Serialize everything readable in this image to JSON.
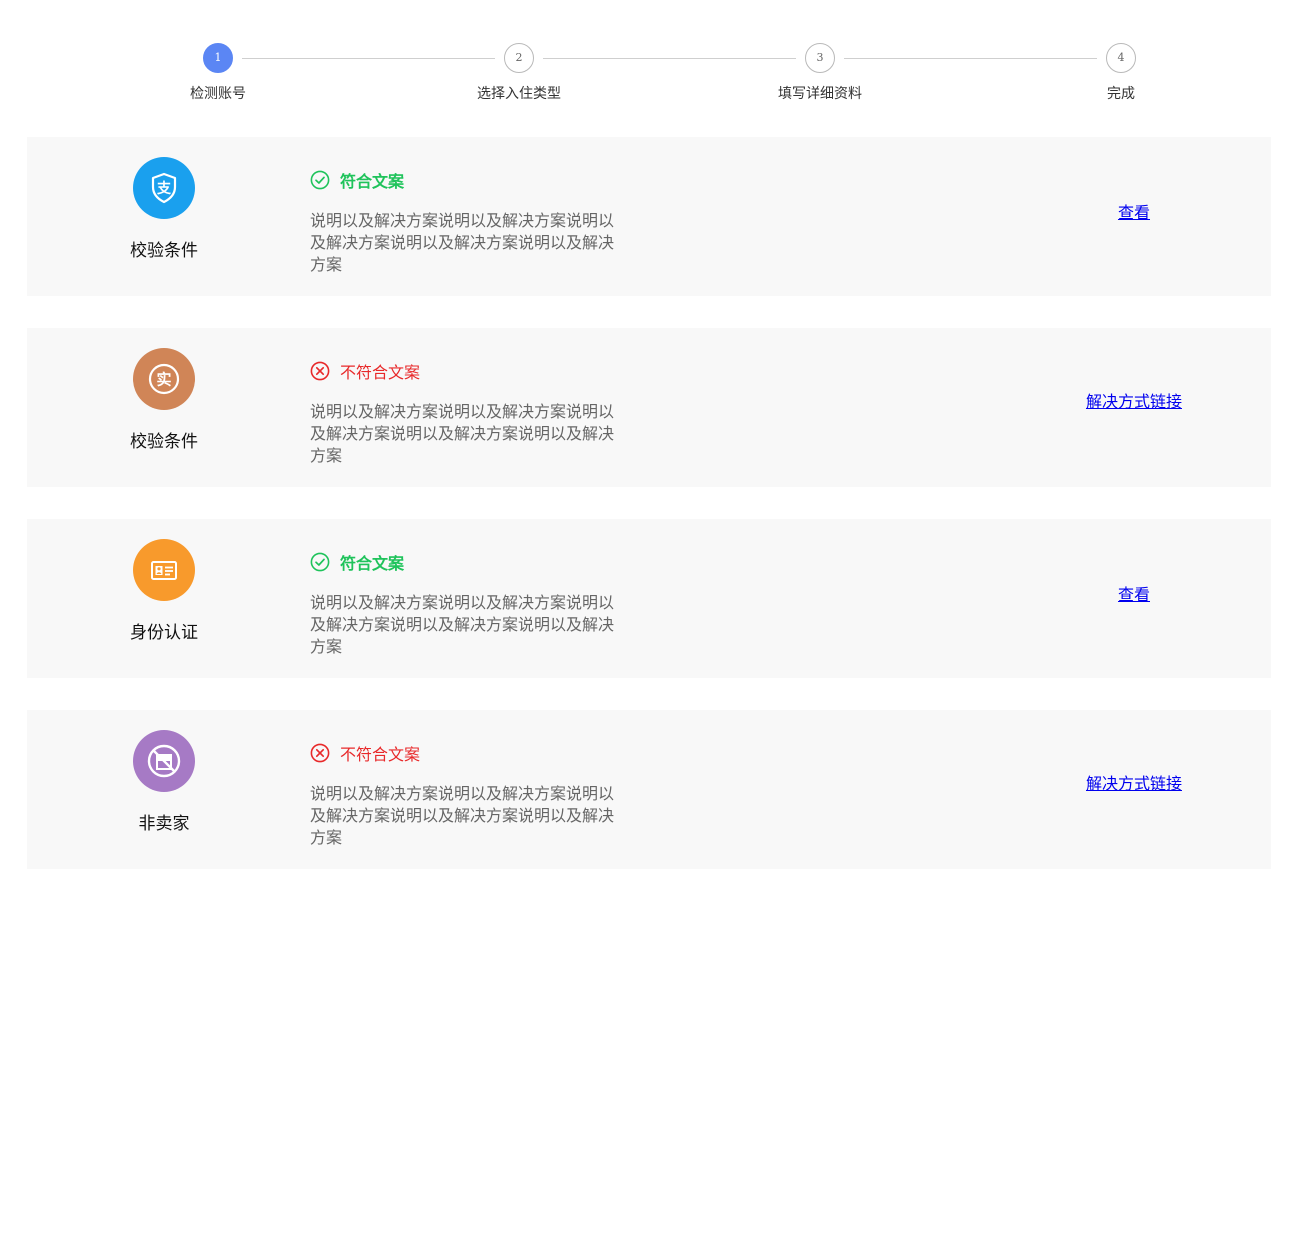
{
  "stepper": {
    "steps": [
      {
        "number": "1",
        "label": "检测账号",
        "state": "active"
      },
      {
        "number": "2",
        "label": "选择入住类型",
        "state": "pending"
      },
      {
        "number": "3",
        "label": "填写详细资料",
        "state": "pending"
      },
      {
        "number": "4",
        "label": "完成",
        "state": "pending"
      }
    ],
    "active_color": "#5b86f4"
  },
  "checks": [
    {
      "name": "校验条件",
      "icon": "alipay-icon",
      "icon_color": "#1aa0ee",
      "status": "pass",
      "status_text": "符合文案",
      "description": "说明以及解决方案说明以及解决方案说明以及解决方案说明以及解决方案说明以及解决方案",
      "link_text": "查看"
    },
    {
      "name": "校验条件",
      "icon": "real-name-icon",
      "icon_color": "#d08557",
      "status": "fail",
      "status_text": "不符合文案",
      "description": "说明以及解决方案说明以及解决方案说明以及解决方案说明以及解决方案说明以及解决方案",
      "link_text": "解决方式链接"
    },
    {
      "name": "身份认证",
      "icon": "id-card-icon",
      "icon_color": "#f89a2c",
      "status": "pass",
      "status_text": "符合文案",
      "description": "说明以及解决方案说明以及解决方案说明以及解决方案说明以及解决方案说明以及解决方案",
      "link_text": "查看"
    },
    {
      "name": "非卖家",
      "icon": "no-store-icon",
      "icon_color": "#a67ac5",
      "status": "fail",
      "status_text": "不符合文案",
      "description": "说明以及解决方案说明以及解决方案说明以及解决方案说明以及解决方案说明以及解决方案",
      "link_text": "解决方式链接"
    }
  ],
  "colors": {
    "pass": "#1fc35b",
    "fail": "#e8292a",
    "link": "#0000ee",
    "row_background": "#f8f8f8"
  }
}
